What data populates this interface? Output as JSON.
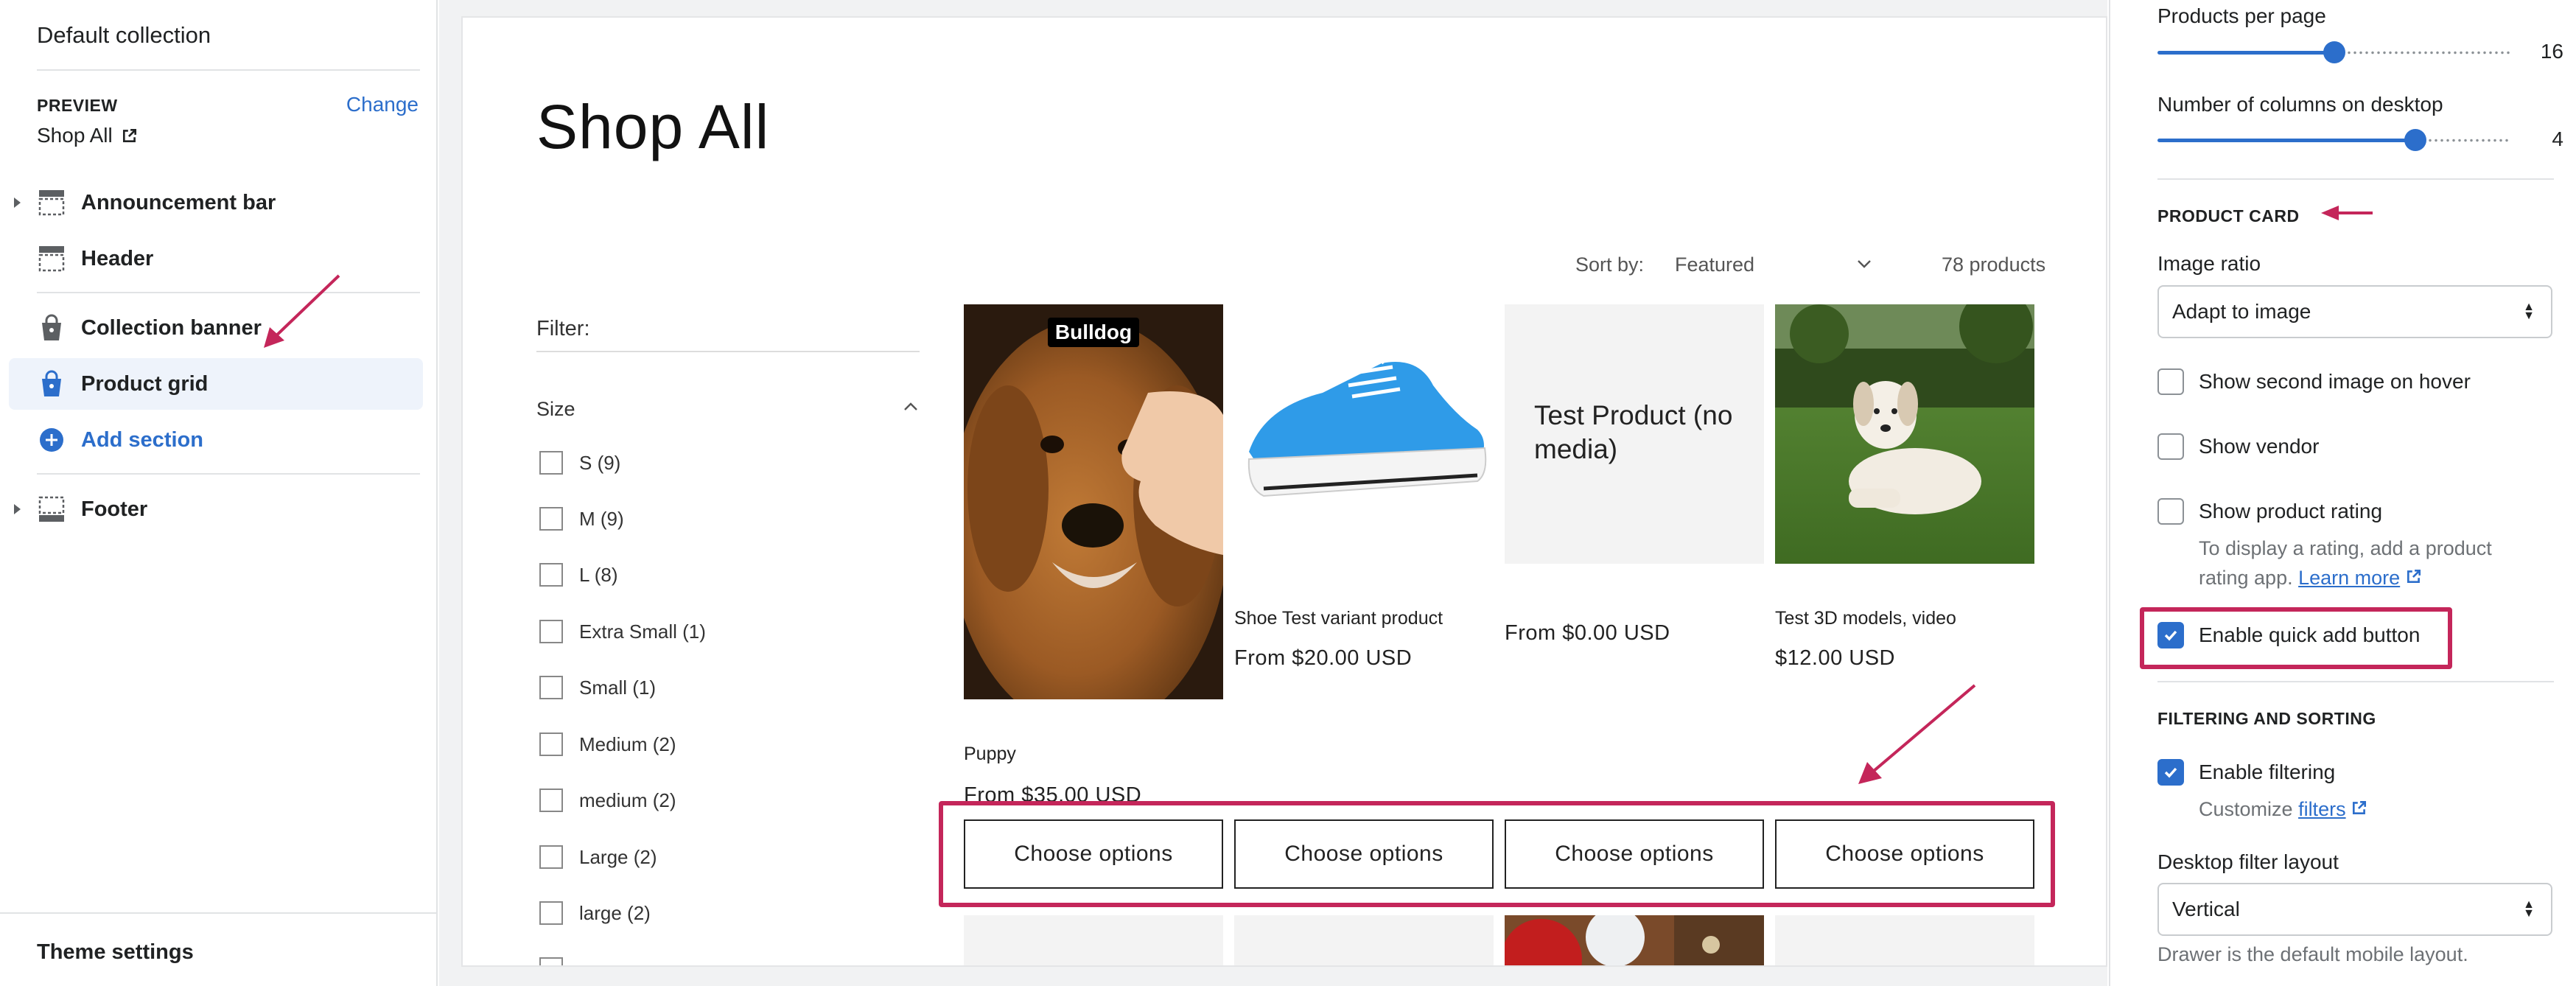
{
  "left": {
    "title": "Default collection",
    "preview_label": "PREVIEW",
    "change_label": "Change",
    "preview_page": "Shop All",
    "sections": [
      {
        "label": "Announcement bar"
      },
      {
        "label": "Header"
      },
      {
        "label": "Collection banner"
      },
      {
        "label": "Product grid"
      },
      {
        "label": "Add section"
      },
      {
        "label": "Footer"
      }
    ],
    "theme_settings": "Theme settings"
  },
  "preview": {
    "title": "Shop All",
    "sort_label": "Sort by:",
    "sort_value": "Featured",
    "count": "78 products",
    "filter_label": "Filter:",
    "size_label": "Size",
    "sizes": [
      "S (9)",
      "M (9)",
      "L (8)",
      "Extra Small (1)",
      "Small (1)",
      "Medium (2)",
      "medium (2)",
      "Large (2)",
      "large (2)"
    ],
    "products": [
      {
        "title": "Puppy",
        "price": "From $35.00 USD",
        "badge": "Bulldog"
      },
      {
        "title": "Shoe Test variant product",
        "price": "From $20.00 USD"
      },
      {
        "title": "",
        "price": "From $0.00 USD",
        "placeholder": "Test Product (no media)"
      },
      {
        "title": "Test 3D models, video",
        "price": "$12.00 USD"
      }
    ],
    "button_label": "Choose options"
  },
  "right": {
    "products_per_page_label": "Products per page",
    "products_per_page": 16,
    "products_per_page_fraction": 0.5,
    "columns_label": "Number of columns on desktop",
    "columns": 4,
    "columns_fraction": 0.73,
    "product_card_heading": "PRODUCT CARD",
    "image_ratio_label": "Image ratio",
    "image_ratio_value": "Adapt to image",
    "show_second_image": "Show second image on hover",
    "show_vendor": "Show vendor",
    "show_rating": "Show product rating",
    "rating_help": "To display a rating, add a product rating app.",
    "learn_more": "Learn more",
    "quick_add": "Enable quick add button",
    "filtering_heading": "FILTERING AND SORTING",
    "enable_filtering": "Enable filtering",
    "customize": "Customize",
    "filters_link": "filters",
    "desktop_filter_label": "Desktop filter layout",
    "desktop_filter_value": "Vertical",
    "drawer_help": "Drawer is the default mobile layout."
  },
  "colors": {
    "accent": "#2c6ecb",
    "annotation": "#c4265a"
  }
}
